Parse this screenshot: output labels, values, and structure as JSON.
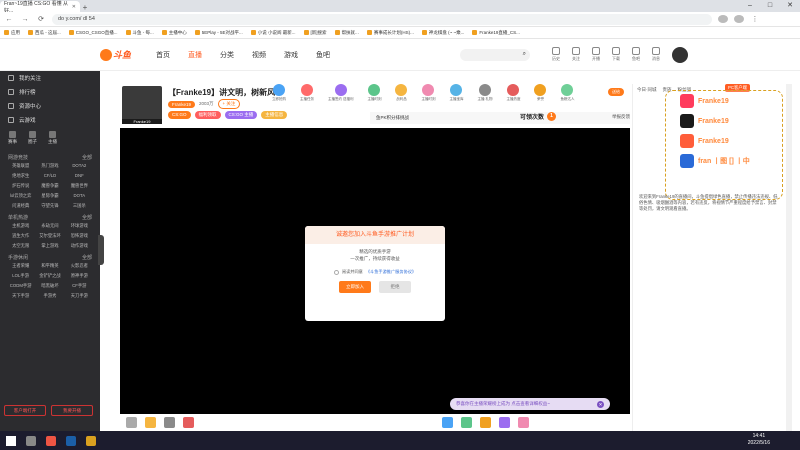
{
  "browser": {
    "tabs": [
      {
        "label": "Fran~19直播 CS:GO 看懂 从好...",
        "active": true
      },
      {
        "label": "",
        "active": false
      },
      {
        "label": "Franke19直播_CS...",
        "active": false
      }
    ],
    "url": "do y.com/  dl 54",
    "bookmarks": [
      "应用",
      "西瓜 - 这届...",
      "CSGO_CSGO直播...",
      "斗鱼 - 每...",
      "主播中心",
      "5EPlay - 5E对战平...",
      "小说 小说阅 最新...",
      "[新]搜索",
      "帮扶就...",
      "赛事成长计划(HS)...",
      "神龙棋盘 (~ ~乘...",
      "Franke19直播_CS..."
    ]
  },
  "site": {
    "logo_text": "斗鱼",
    "nav": [
      "首页",
      "直播",
      "分类",
      "视频",
      "游戏",
      "鱼吧"
    ],
    "active_nav": "直播",
    "header_icons": [
      "历史",
      "关注",
      "开播",
      "下载",
      "鱼吧",
      "消息"
    ]
  },
  "sidebar": {
    "items": [
      "我的关注",
      "排行榜",
      "资源中心",
      "云游戏"
    ],
    "icon_row": [
      "赛事",
      "圈子",
      "主播"
    ],
    "sections": [
      {
        "title": "网游竞技",
        "more": "全部",
        "games": [
          "英雄联盟",
          "热门游戏",
          "DOTA2",
          "绝地求生",
          "CF/LD",
          "DNF",
          "炉石传说",
          "魔兽争霸",
          "魔兽世界",
          "lol云顶之弈",
          "星际争霸",
          "DOTA",
          "问道经典",
          "守望先锋",
          "三国杀"
        ]
      },
      {
        "title": "单机热游",
        "more": "全部",
        "games": [
          "主机游戏",
          "永劫无间",
          "环球游戏",
          "逃生大作",
          "艾尔登法环",
          "恐怖游戏",
          "太空无限",
          "掌上游戏",
          "动作游戏"
        ]
      },
      {
        "title": "手游休闲",
        "more": "全部",
        "games": [
          "王者荣耀",
          "和平精英",
          "火影忍者",
          "LOL手游",
          "金铲铲之战",
          "原神手游",
          "CODM手游",
          "暗黑破坏",
          "CF手游",
          "天下手游",
          "手游秀",
          "天刀手游"
        ]
      }
    ],
    "bottom_buttons": [
      "客户端打开",
      "我要开播"
    ]
  },
  "room": {
    "streamer_tag": "Franke19",
    "title": "【Franke19】讲文明，树新风！",
    "anchor_name": "Franke19",
    "hot": "2003万",
    "follow_label": "+ 关注",
    "tags": [
      "CS:GO",
      "福利领取",
      "CS:GO 主播",
      "主播信息"
    ],
    "rank_text": "鱼PK积分排挑战",
    "cdk_label": "可领次数",
    "cdk_count": "1",
    "report_label": "举报反馈",
    "orange_badge": "送给",
    "gifts": [
      {
        "label": "立即抢购",
        "color": "#4aa3f5"
      },
      {
        "label": "主播任务",
        "color": "#ff6a6a"
      },
      {
        "label": "主播签约 送福利",
        "color": "#9b6df0"
      },
      {
        "label": "主播时刻",
        "color": "#5cc58a"
      },
      {
        "label": "战利品",
        "color": "#f5b540"
      },
      {
        "label": "主播时刻",
        "color": "#f08ab0"
      },
      {
        "label": "主播宝库",
        "color": "#56b3e6"
      },
      {
        "label": "主播 礼物",
        "color": "#8a8a8a"
      },
      {
        "label": "主播热度",
        "color": "#e55c5c"
      },
      {
        "label": "荣誉",
        "color": "#f0a020"
      },
      {
        "label": "鱼粮达人",
        "color": "#6fcf97"
      }
    ]
  },
  "modal": {
    "title": "诚邀您加入斗鱼手游推广计划",
    "body_line1": "精选的优质手游",
    "body_line2": "一次推广，持续获得收益",
    "agree_prefix": "阅读并同意",
    "agree_link": "《斗鱼手游推广服务协议》",
    "confirm": "立即加入",
    "cancel": "拒绝"
  },
  "notice": {
    "text": "恭喜你在主播荣耀榜上成为 点击查看详细权益~"
  },
  "chat": {
    "tabs": [
      "今日·同城",
      "贵族",
      "粉丝团"
    ],
    "pc_button": "PC客户端",
    "overlay_rows": [
      {
        "icon": "#ff3b5c",
        "text": "Franke19"
      },
      {
        "icon": "#1a1a1a",
        "text": "Franke19"
      },
      {
        "icon": "#ff5d3a",
        "text": "Franke19"
      },
      {
        "icon": "#2a6ad7",
        "text": "fran 丨图 [] 丨中"
      }
    ],
    "messages": [
      "欢迎来到Franke19的直播间",
      "系统：弹幕信息"
    ],
    "long_text": "欢迎来到Franke19的直播间，斗鱼提倡绿色直播，禁止传播违法违规、低俗色情、吸烟酗酒等内容，若有违反，将视情节严重程度给予禁言、封禁等处罚，请文明观看直播。"
  },
  "taskbar": {
    "time": "14:41",
    "date": "2022/5/16"
  }
}
